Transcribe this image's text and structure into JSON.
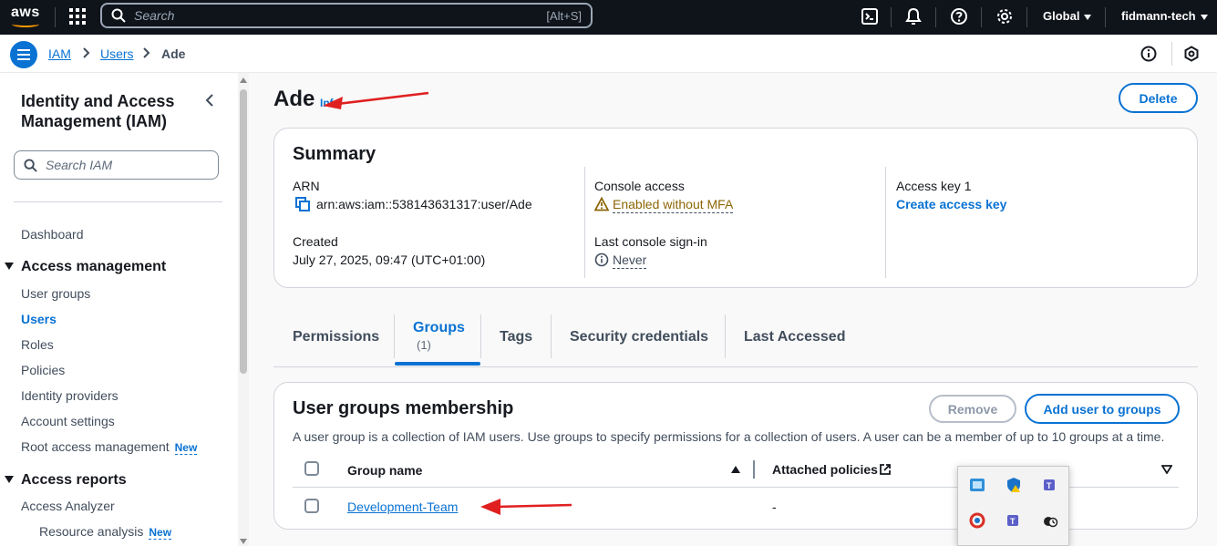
{
  "topnav": {
    "logo": "aws",
    "search_placeholder": "Search",
    "search_shortcut": "[Alt+S]",
    "region": "Global",
    "account": "fidmann-tech",
    "icons": [
      "apps-grid-icon",
      "search-icon",
      "cloudshell-icon",
      "bell-icon",
      "help-icon",
      "gear-icon"
    ]
  },
  "breadcrumb": {
    "items": [
      "IAM",
      "Users",
      "Ade"
    ]
  },
  "sidebar": {
    "title": "Identity and Access Management (IAM)",
    "search_placeholder": "Search IAM",
    "dashboard": "Dashboard",
    "section_access_management": "Access management",
    "items_access_management": [
      "User groups",
      "Users",
      "Roles",
      "Policies",
      "Identity providers",
      "Account settings",
      "Root access management"
    ],
    "section_access_reports": "Access reports",
    "items_access_reports": [
      "Access Analyzer",
      "Resource analysis"
    ],
    "new_badge": "New"
  },
  "page": {
    "title": "Ade",
    "info": "Info",
    "delete_button": "Delete"
  },
  "summary": {
    "title": "Summary",
    "arn_label": "ARN",
    "arn_value": "arn:aws:iam::538143631317:user/Ade",
    "created_label": "Created",
    "created_value": "July 27, 2025, 09:47 (UTC+01:00)",
    "console_access_label": "Console access",
    "console_access_value": "Enabled without MFA",
    "last_signin_label": "Last console sign-in",
    "last_signin_value": "Never",
    "access_key_label": "Access key 1",
    "access_key_link": "Create access key"
  },
  "tabs": {
    "permissions": "Permissions",
    "groups": "Groups",
    "groups_count": "(1)",
    "tags": "Tags",
    "security_credentials": "Security credentials",
    "last_accessed": "Last Accessed"
  },
  "groups_panel": {
    "title": "User groups membership",
    "remove_button": "Remove",
    "add_button": "Add user to groups",
    "description": "A user group is a collection of IAM users. Use groups to specify permissions for a collection of users. A user can be a member of up to 10 groups at a time.",
    "col_group_name": "Group name",
    "col_attached_policies": "Attached policies",
    "rows": [
      {
        "group_name": "Development-Team",
        "attached_policies": "-"
      }
    ]
  },
  "colors": {
    "accent": "#0972d3",
    "nav_bg": "#0f141a",
    "warning": "#8d6605",
    "annotation_arrow": "#e02020"
  }
}
